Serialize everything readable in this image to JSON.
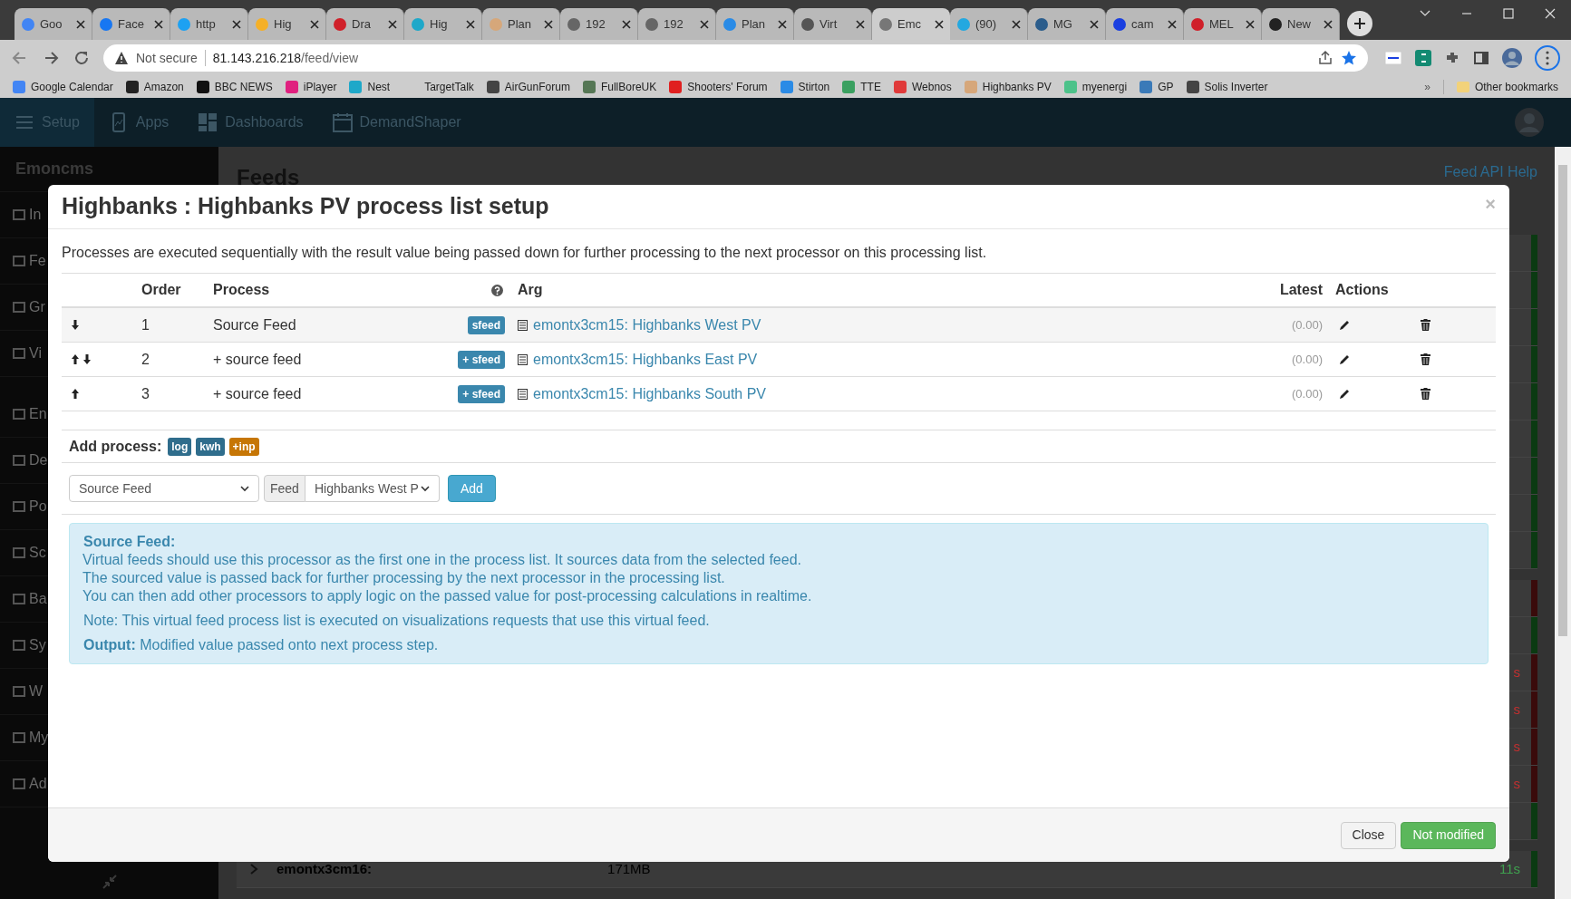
{
  "browser": {
    "tabs": [
      {
        "title": "Goo",
        "color": "#4285f4",
        "selected": false
      },
      {
        "title": "Face",
        "color": "#1877f2",
        "selected": false
      },
      {
        "title": "http",
        "color": "#1da1f2",
        "selected": false
      },
      {
        "title": "Hig",
        "color": "#f5b027",
        "selected": false
      },
      {
        "title": "Dra",
        "color": "#d0202a",
        "selected": false
      },
      {
        "title": "Hig",
        "color": "#1ea8c9",
        "selected": false
      },
      {
        "title": "Plan",
        "color": "#d6a77a",
        "selected": false
      },
      {
        "title": "192",
        "color": "#666666",
        "selected": false
      },
      {
        "title": "192",
        "color": "#666666",
        "selected": false
      },
      {
        "title": "Plan",
        "color": "#2a8be6",
        "selected": false
      },
      {
        "title": "Virt",
        "color": "#555555",
        "selected": false
      },
      {
        "title": "Emc",
        "color": "#777777",
        "selected": true
      },
      {
        "title": "(90)",
        "color": "#23a8e0",
        "selected": false
      },
      {
        "title": "MG",
        "color": "#2b5d8c",
        "selected": false
      },
      {
        "title": "cam",
        "color": "#1a3fe0",
        "selected": false
      },
      {
        "title": "MEL",
        "color": "#d0202a",
        "selected": false
      },
      {
        "title": "New",
        "color": "#222222",
        "selected": false
      }
    ],
    "security": "Not secure",
    "url_host": "81.143.216.218",
    "url_path": "/feed/view",
    "bookmarks": [
      {
        "label": "Google Calendar",
        "color": "#4285f4"
      },
      {
        "label": "Amazon",
        "color": "#222222"
      },
      {
        "label": "BBC NEWS",
        "color": "#111111"
      },
      {
        "label": "iPlayer",
        "color": "#e0207f"
      },
      {
        "label": "Nest",
        "color": "#1ea8c9"
      },
      {
        "label": "TargetTalk"
      },
      {
        "label": "AirGunForum",
        "color": "#444444"
      },
      {
        "label": "FullBoreUK",
        "color": "#557755"
      },
      {
        "label": "Shooters' Forum",
        "color": "#e02020"
      },
      {
        "label": "Stirton",
        "color": "#2a8be6"
      },
      {
        "label": "TTE",
        "color": "#3aa060"
      },
      {
        "label": "Webnos",
        "color": "#e03a3a"
      },
      {
        "label": "Highbanks PV",
        "color": "#d6a77a"
      },
      {
        "label": "myenergi",
        "color": "#4cc28a"
      },
      {
        "label": "GP",
        "color": "#3a7ab8"
      },
      {
        "label": "Solis Inverter",
        "color": "#444444"
      }
    ],
    "more": "»",
    "other_bookmarks": "Other bookmarks"
  },
  "app": {
    "nav": [
      {
        "label": "Setup",
        "selected": true
      },
      {
        "label": "Apps",
        "selected": false
      },
      {
        "label": "Dashboards",
        "selected": false
      },
      {
        "label": "DemandShaper",
        "selected": false
      }
    ],
    "sidebar_title": "Emoncms",
    "sidebar_groups": [
      [
        "In",
        "Fe",
        "Gr",
        "Vi"
      ],
      [
        "En",
        "De",
        "Po",
        "Sc",
        "Ba",
        "Sy",
        "W",
        "My",
        "Ad"
      ]
    ],
    "page_title": "Feeds",
    "api_help": "Feed API Help",
    "feed_groups": [
      {
        "rows": [
          {
            "color": "#0b3a12"
          },
          {
            "color": "#0b3a12"
          },
          {
            "color": "#0b3a12"
          },
          {
            "color": "#0b3a12"
          },
          {
            "color": "#0b3a12"
          },
          {
            "color": "#0b3a12"
          },
          {
            "color": "#0b3a12"
          },
          {
            "color": "#0b3a12"
          },
          {
            "color": "#0b3a12"
          }
        ]
      },
      {
        "rows": [
          {
            "color": "#3a0b0b"
          },
          {
            "color": "#0b3a12"
          },
          {
            "color": "#3a0b0b",
            "time": "s"
          },
          {
            "color": "#3a0b0b",
            "time": "s"
          },
          {
            "color": "#3a0b0b",
            "time": "s"
          },
          {
            "color": "#3a0b0b",
            "time": "s"
          },
          {
            "color": "#0b3a12"
          }
        ]
      },
      {
        "rows": [
          {
            "color": "#0b3a12",
            "name": "emontx3cm16:",
            "size": "171MB",
            "time": "11s"
          }
        ]
      }
    ]
  },
  "modal": {
    "title": "Highbanks : Highbanks PV process list setup",
    "close": "×",
    "description": "Processes are executed sequentially with the result value being passed down for further processing to the next processor on this processing list.",
    "columns": [
      "Order",
      "Process",
      "Arg",
      "Latest",
      "Actions"
    ],
    "rows": [
      {
        "move_up": false,
        "move_down": true,
        "order": "1",
        "process": "Source Feed",
        "badge": "sfeed",
        "arg": "emontx3cm15: Highbanks West PV",
        "latest": "(0.00)"
      },
      {
        "move_up": true,
        "move_down": true,
        "order": "2",
        "process": "+ source feed",
        "badge": "+ sfeed",
        "arg": "emontx3cm15: Highbanks East PV",
        "latest": "(0.00)"
      },
      {
        "move_up": true,
        "move_down": false,
        "order": "3",
        "process": "+ source feed",
        "badge": "+ sfeed",
        "arg": "emontx3cm15: Highbanks South PV",
        "latest": "(0.00)"
      }
    ],
    "add_label": "Add process:",
    "add_tags": [
      {
        "label": "log",
        "color": "#2f6d8c"
      },
      {
        "label": "kwh",
        "color": "#2f6d8c"
      },
      {
        "label": "+inp",
        "color": "#c67605"
      }
    ],
    "process_select": "Source Feed",
    "feed_label": "Feed",
    "feed_select": "Highbanks West P",
    "add_button": "Add",
    "info": {
      "title": "Source Feed:",
      "lines": [
        "Virtual feeds should use this processor as the first one in the process list. It sources data from the selected feed.",
        "The sourced value is passed back for further processing by the next processor in the processing list.",
        "You can then add other processors to apply logic on the passed value for post-processing calculations in realtime."
      ],
      "note": "Note: This virtual feed process list is executed on visualizations requests that use this virtual feed.",
      "output": "**Output:** Modified value passed onto next process step."
    },
    "buttons": [
      {
        "label": "Close",
        "kind": "default"
      },
      {
        "label": "Not modified",
        "kind": "success"
      }
    ]
  }
}
